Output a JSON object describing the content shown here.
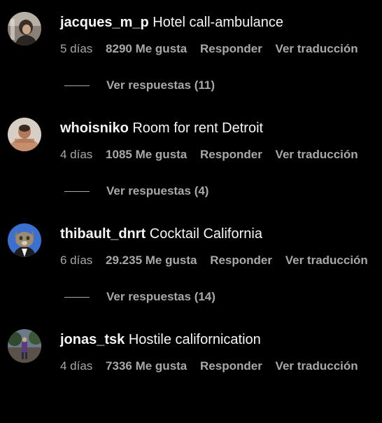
{
  "comments": [
    {
      "username": "jacques_m_p",
      "text": "Hotel call-ambulance",
      "time": "5 días",
      "likes": "8290 Me gusta",
      "reply": "Responder",
      "translate": "Ver traducción",
      "replies": "Ver respuestas (11)",
      "avatar_icon": "profile-photo"
    },
    {
      "username": "whoisniko",
      "text": "Room for rent Detroit",
      "time": "4 días",
      "likes": "1085 Me gusta",
      "reply": "Responder",
      "translate": "Ver traducción",
      "replies": "Ver respuestas (4)",
      "avatar_icon": "profile-photo"
    },
    {
      "username": "thibault_dnrt",
      "text": "Cocktail California",
      "time": "6 días",
      "likes": "29.235 Me gusta",
      "reply": "Responder",
      "translate": "Ver traducción",
      "replies": "Ver respuestas (14)",
      "avatar_icon": "profile-photo"
    },
    {
      "username": "jonas_tsk",
      "text": "Hostile californication",
      "time": "4 días",
      "likes": "7336 Me gusta",
      "reply": "Responder",
      "translate": "Ver traducción",
      "avatar_icon": "profile-photo"
    }
  ],
  "colors": {
    "background": "#000000",
    "primary_text": "#f5f5f5",
    "secondary_text": "#a8a8a8"
  }
}
